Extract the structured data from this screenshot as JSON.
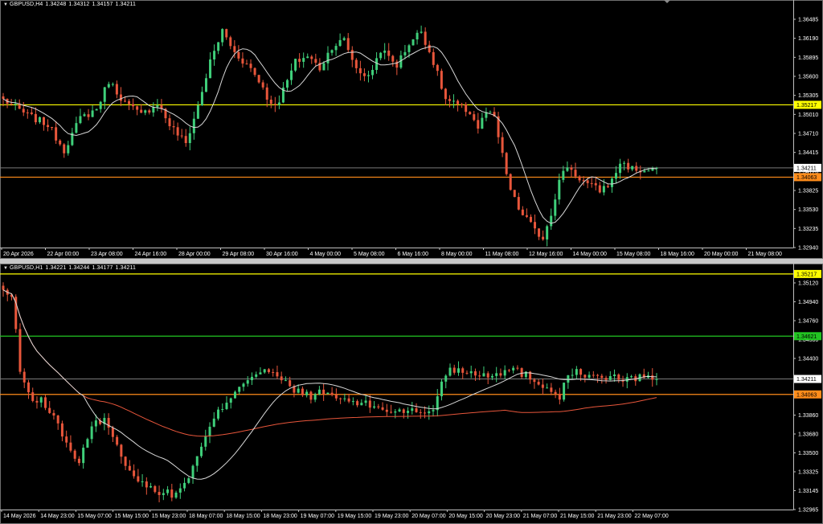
{
  "colors": {
    "bull": "#3fcf7a",
    "bear": "#e8563b",
    "ma_fast": "#d8d8d8",
    "ma_slow": "#e8563b",
    "level_yellow": "#ffff00",
    "level_orange": "#ff8c1a",
    "level_green": "#22c422",
    "bid_line": "#7a7a7a",
    "axis_text": "#ffffff"
  },
  "chart_data": [
    {
      "type": "candlestick",
      "symbol": "GBPUSD,H4",
      "ohlc_header": [
        "1.34248",
        "1.34312",
        "1.34157",
        "1.34211"
      ],
      "ylim": [
        1.3294,
        1.3671
      ],
      "y_ticks": [
        "1.36485",
        "1.36190",
        "1.35895",
        "1.35600",
        "1.35305",
        "1.35010",
        "1.34710",
        "1.34415",
        "1.34120",
        "1.33825",
        "1.33530",
        "1.33235",
        "1.32940"
      ],
      "x_ticks": [
        "20 Apr 2026",
        "22 Apr 00:00",
        "23 Apr 08:00",
        "24 Apr 16:00",
        "28 Apr 00:00",
        "29 Apr 08:00",
        "30 Apr 16:00",
        "4 May 00:00",
        "5 May 08:00",
        "6 May 16:00",
        "8 May 00:00",
        "11 May 08:00",
        "12 May 16:00",
        "14 May 00:00",
        "15 May 08:00",
        "18 May 16:00",
        "20 May 00:00",
        "21 May 08:00"
      ],
      "levels": [
        {
          "price": 1.35217,
          "label": "1.35217",
          "color": "level_yellow"
        },
        {
          "price": 1.34063,
          "label": "1.34063",
          "color": "level_orange"
        }
      ],
      "bid": {
        "price": 1.34211,
        "label": "1.34211"
      },
      "anchors": [
        [
          0,
          1.353
        ],
        [
          6,
          1.3505
        ],
        [
          11,
          1.349
        ],
        [
          15,
          1.345
        ],
        [
          19,
          1.35
        ],
        [
          23,
          1.3515
        ],
        [
          26,
          1.356
        ],
        [
          30,
          1.3525
        ],
        [
          34,
          1.3505
        ],
        [
          38,
          1.3525
        ],
        [
          41,
          1.349
        ],
        [
          45,
          1.346
        ],
        [
          48,
          1.352
        ],
        [
          51,
          1.359
        ],
        [
          54,
          1.364
        ],
        [
          57,
          1.3605
        ],
        [
          61,
          1.358
        ],
        [
          64,
          1.355
        ],
        [
          66,
          1.352
        ],
        [
          68,
          1.353
        ],
        [
          72,
          1.359
        ],
        [
          75,
          1.36
        ],
        [
          78,
          1.358
        ],
        [
          81,
          1.3615
        ],
        [
          84,
          1.3625
        ],
        [
          87,
          1.358
        ],
        [
          90,
          1.3565
        ],
        [
          93,
          1.361
        ],
        [
          97,
          1.3585
        ],
        [
          100,
          1.362
        ],
        [
          103,
          1.364
        ],
        [
          106,
          1.359
        ],
        [
          109,
          1.353
        ],
        [
          112,
          1.352
        ],
        [
          115,
          1.351
        ],
        [
          117,
          1.3485
        ],
        [
          119,
          1.351
        ],
        [
          121,
          1.35
        ],
        [
          123,
          1.344
        ],
        [
          125,
          1.3385
        ],
        [
          127,
          1.3355
        ],
        [
          129,
          1.334
        ],
        [
          131,
          1.332
        ],
        [
          133,
          1.331
        ],
        [
          135,
          1.335
        ],
        [
          137,
          1.34
        ],
        [
          139,
          1.3425
        ],
        [
          141,
          1.341
        ],
        [
          144,
          1.3395
        ],
        [
          147,
          1.3385
        ],
        [
          150,
          1.34
        ],
        [
          152,
          1.343
        ],
        [
          155,
          1.342
        ],
        [
          158,
          1.3415
        ],
        [
          161,
          1.3421
        ]
      ],
      "ma_period": 9
    },
    {
      "type": "candlestick",
      "symbol": "GBPUSD,H1",
      "ohlc_header": [
        "1.34221",
        "1.34244",
        "1.34177",
        "1.34211"
      ],
      "ylim": [
        1.3296,
        1.3527
      ],
      "y_ticks": [
        "1.35120",
        "1.34940",
        "1.34760",
        "1.34580",
        "1.34400",
        "1.34211",
        "1.34040",
        "1.33860",
        "1.33680",
        "1.33500",
        "1.33325",
        "1.33145",
        "1.32965"
      ],
      "x_ticks": [
        "14 May 2026",
        "14 May 23:00",
        "15 May 07:00",
        "15 May 15:00",
        "15 May 23:00",
        "18 May 07:00",
        "18 May 15:00",
        "18 May 23:00",
        "19 May 07:00",
        "19 May 15:00",
        "19 May 23:00",
        "20 May 07:00",
        "20 May 15:00",
        "20 May 23:00",
        "21 May 07:00",
        "21 May 15:00",
        "21 May 23:00",
        "22 May 07:00"
      ],
      "levels": [
        {
          "price": 1.35217,
          "label": "1.35217",
          "color": "level_yellow"
        },
        {
          "price": 1.34621,
          "label": "1.34621",
          "color": "level_green"
        },
        {
          "price": 1.34063,
          "label": "1.34063",
          "color": "level_orange"
        }
      ],
      "bid": {
        "price": 1.34211,
        "label": "1.34211"
      },
      "anchors": [
        [
          0,
          1.3505
        ],
        [
          2,
          1.35
        ],
        [
          4,
          1.343
        ],
        [
          6,
          1.3405
        ],
        [
          9,
          1.34
        ],
        [
          12,
          1.3385
        ],
        [
          15,
          1.336
        ],
        [
          18,
          1.334
        ],
        [
          21,
          1.3375
        ],
        [
          24,
          1.3385
        ],
        [
          27,
          1.3355
        ],
        [
          30,
          1.3335
        ],
        [
          33,
          1.332
        ],
        [
          36,
          1.3315
        ],
        [
          40,
          1.331
        ],
        [
          43,
          1.332
        ],
        [
          46,
          1.3345
        ],
        [
          49,
          1.3375
        ],
        [
          52,
          1.3395
        ],
        [
          56,
          1.3415
        ],
        [
          59,
          1.3425
        ],
        [
          62,
          1.343
        ],
        [
          66,
          1.342
        ],
        [
          69,
          1.341
        ],
        [
          73,
          1.3405
        ],
        [
          76,
          1.3408
        ],
        [
          80,
          1.3402
        ],
        [
          84,
          1.3398
        ],
        [
          88,
          1.3395
        ],
        [
          92,
          1.339
        ],
        [
          96,
          1.3392
        ],
        [
          99,
          1.3387
        ],
        [
          102,
          1.3392
        ],
        [
          104,
          1.342
        ],
        [
          106,
          1.343
        ],
        [
          108,
          1.343
        ],
        [
          111,
          1.3428
        ],
        [
          114,
          1.3425
        ],
        [
          118,
          1.3428
        ],
        [
          121,
          1.343
        ],
        [
          124,
          1.3425
        ],
        [
          127,
          1.3418
        ],
        [
          130,
          1.341
        ],
        [
          132,
          1.3405
        ],
        [
          134,
          1.3425
        ],
        [
          137,
          1.3428
        ],
        [
          140,
          1.3422
        ],
        [
          144,
          1.3423
        ],
        [
          148,
          1.342
        ],
        [
          152,
          1.3424
        ],
        [
          155,
          1.3421
        ]
      ],
      "ma_fast_period": 20,
      "ma_slow_period": 120
    }
  ]
}
